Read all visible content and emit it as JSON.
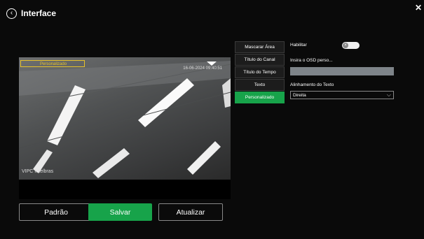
{
  "header": {
    "title": "Interface"
  },
  "preview": {
    "osd_label": "Personalizado",
    "timestamp": "16-06-2024 09:40:51",
    "channel_name": "VIPC Intelbras"
  },
  "actions": {
    "default_label": "Padrão",
    "save_label": "Salvar",
    "refresh_label": "Atualizar"
  },
  "tabs": [
    {
      "label": "Mascarar Área"
    },
    {
      "label": "Título do Canal"
    },
    {
      "label": "Título do Tempo"
    },
    {
      "label": "Texto"
    },
    {
      "label": "Personalizado",
      "active": true
    }
  ],
  "settings": {
    "enable_label": "Habilitar",
    "enabled": false,
    "osd_prompt": "Insira o OSD perso...",
    "osd_value": "",
    "align_label": "Alinhamento do Texto",
    "align_value": "Direita"
  },
  "colors": {
    "accent": "#17a34a",
    "input_bg": "#7e8489"
  }
}
